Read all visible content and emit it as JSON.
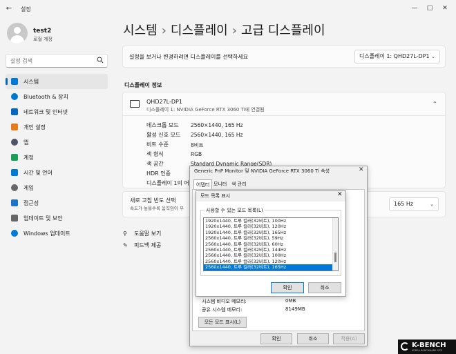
{
  "app": {
    "title": "설정"
  },
  "user": {
    "name": "test2",
    "subtitle": "로컬 계정"
  },
  "search": {
    "placeholder": "설정 검색"
  },
  "sidebar": {
    "items": [
      {
        "label": "시스템",
        "icon": "system-icon",
        "color": "#0078d4",
        "active": true
      },
      {
        "label": "Bluetooth & 장치",
        "icon": "bluetooth-icon",
        "color": "#0078d4"
      },
      {
        "label": "네트워크 및 인터넷",
        "icon": "network-icon",
        "color": "#0067c0"
      },
      {
        "label": "개인 설정",
        "icon": "brush-icon",
        "color": "#e87a1c"
      },
      {
        "label": "앱",
        "icon": "apps-icon",
        "color": "#4a5568"
      },
      {
        "label": "계정",
        "icon": "account-icon",
        "color": "#18a058"
      },
      {
        "label": "시간 및 언어",
        "icon": "globe-clock-icon",
        "color": "#0078d4"
      },
      {
        "label": "게임",
        "icon": "gamepad-icon",
        "color": "#666666"
      },
      {
        "label": "접근성",
        "icon": "accessibility-icon",
        "color": "#1a73c8"
      },
      {
        "label": "업데이트 및 보안",
        "icon": "shield-icon",
        "color": "#666666"
      },
      {
        "label": "Windows 업데이트",
        "icon": "windows-update-icon",
        "color": "#0078d4"
      }
    ]
  },
  "breadcrumb": [
    "시스템",
    "디스플레이",
    "고급 디스플레이"
  ],
  "display_select": {
    "prompt": "설정을 보거나 변경하려면 디스플레이를 선택하세요",
    "value": "디스플레이 1: QHD27L-DP1"
  },
  "info": {
    "section_title": "디스플레이 정보",
    "monitor_name": "QHD27L-DP1",
    "monitor_sub": "디스플레이 1: NVIDIA GeForce RTX 3060 Ti에 연결됨",
    "specs": [
      {
        "label": "데스크톱 모드",
        "value": "2560×1440, 165 Hz"
      },
      {
        "label": "활성 신호 모드",
        "value": "2560×1440, 165 Hz"
      },
      {
        "label": "비트 수준",
        "value": "8비트"
      },
      {
        "label": "색 형식",
        "value": "RGB"
      },
      {
        "label": "색 공간",
        "value": "Standard Dynamic Range(SDR)"
      },
      {
        "label": "HDR 인증",
        "value": ""
      },
      {
        "label": "디스플레이 1의 어",
        "value": ""
      }
    ]
  },
  "refresh": {
    "title": "새로 고침 빈도 선택",
    "subtitle": "속도가 높을수록 움직임이 부",
    "value": "165 Hz"
  },
  "links": {
    "help": "도움말 보기",
    "feedback": "피드백 제공"
  },
  "props_dialog": {
    "title": "Generic PnP Monitor 및 NVIDIA GeForce RTX 3060 Ti 속성",
    "tabs": [
      "어댑터",
      "모니터",
      "색 관리"
    ],
    "memory": [
      {
        "label": "시스템 비디오 메모리:",
        "value": "0MB"
      },
      {
        "label": "공유 시스템 메모리:",
        "value": "8149MB"
      }
    ],
    "list_all_modes": "모든 모드 표시(L)",
    "ok": "확인",
    "cancel": "취소",
    "apply": "적용(A)"
  },
  "modes_dialog": {
    "title": "모드 목록 표시",
    "group_label": "사용할 수 있는 모드 목록(L)",
    "modes": [
      "1920x1440, 트루 컬러(32비트), 100Hz",
      "1920x1440, 트루 컬러(32비트), 120Hz",
      "1920x1440, 트루 컬러(32비트), 165Hz",
      "2560x1440, 트루 컬러(32비트), 59Hz",
      "2560x1440, 트루 컬러(32비트), 60Hz",
      "2560x1440, 트루 컬러(32비트), 144Hz",
      "2560x1440, 트루 컬러(32비트), 100Hz",
      "2560x1440, 트루 컬러(32비트), 120Hz",
      "2560x1440, 트루 컬러(32비트), 165Hz"
    ],
    "selected_index": 8,
    "ok": "확인",
    "cancel": "취소"
  },
  "watermark": {
    "brand": "K-BENCH",
    "tagline": "KOREA BENCHMARK SITE"
  }
}
